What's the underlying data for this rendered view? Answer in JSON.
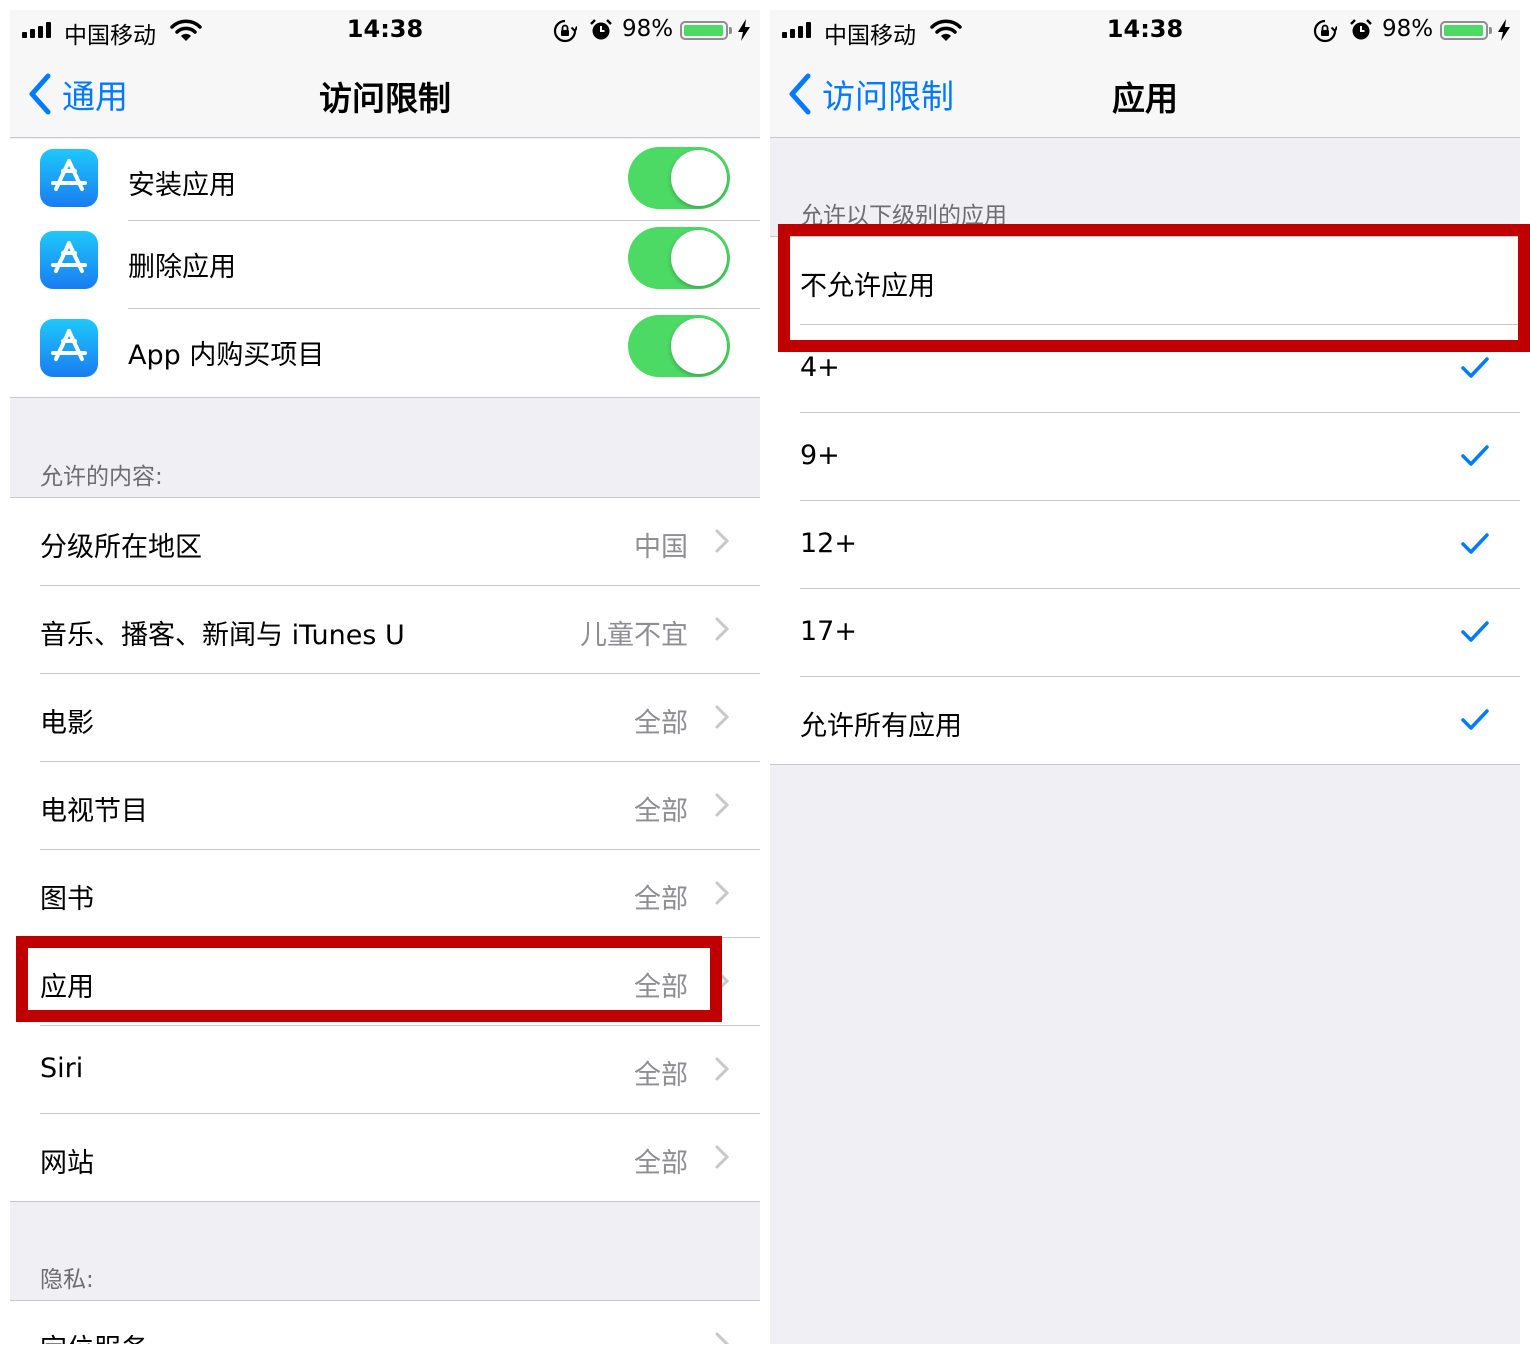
{
  "status_bar": {
    "carrier": "中国移动",
    "time": "14:38",
    "battery_percent": "98%",
    "battery_level": 0.98,
    "icons": [
      "signal-icon",
      "wifi-icon",
      "rotation-lock-icon",
      "alarm-icon",
      "battery-icon",
      "charging-bolt-icon"
    ]
  },
  "left_screen": {
    "nav": {
      "back_label": "通用",
      "title": "访问限制"
    },
    "app_rows": [
      {
        "label": "安装应用",
        "enabled": true
      },
      {
        "label": "删除应用",
        "enabled": true
      },
      {
        "label": "App 内购买项目",
        "enabled": true
      }
    ],
    "content_header": "允许的内容:",
    "content_rows": [
      {
        "label": "分级所在地区",
        "value": "中国"
      },
      {
        "label": "音乐、播客、新闻与 iTunes U",
        "value": "儿童不宜"
      },
      {
        "label": "电影",
        "value": "全部"
      },
      {
        "label": "电视节目",
        "value": "全部"
      },
      {
        "label": "图书",
        "value": "全部"
      },
      {
        "label": "应用",
        "value": "全部"
      },
      {
        "label": "Siri",
        "value": "全部"
      },
      {
        "label": "网站",
        "value": "全部"
      }
    ],
    "privacy_header": "隐私:",
    "privacy_rows": [
      {
        "label": "定位服务",
        "value": ""
      }
    ]
  },
  "right_screen": {
    "nav": {
      "back_label": "访问限制",
      "title": "应用"
    },
    "section_header": "允许以下级别的应用",
    "options": [
      {
        "label": "不允许应用",
        "checked": false
      },
      {
        "label": "4+",
        "checked": true
      },
      {
        "label": "9+",
        "checked": true
      },
      {
        "label": "12+",
        "checked": true
      },
      {
        "label": "17+",
        "checked": true
      },
      {
        "label": "允许所有应用",
        "checked": true
      }
    ]
  },
  "colors": {
    "accent": "#007aff",
    "toggle_on": "#4cd964",
    "highlight": "#c00000",
    "background": "#efeff4",
    "secondary_text": "#8e8e93"
  }
}
